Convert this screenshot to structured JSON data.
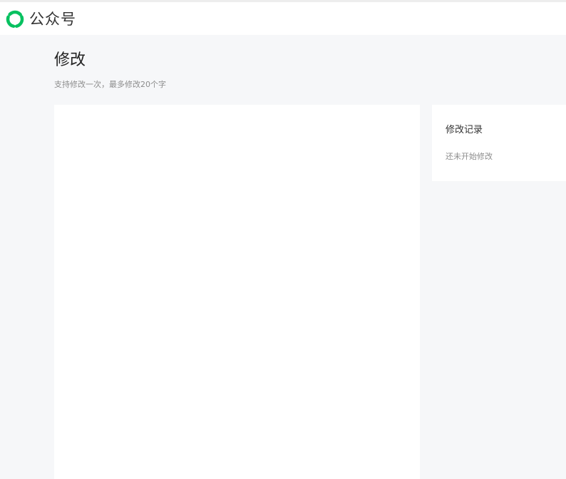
{
  "header": {
    "brand_name": "公众号",
    "logo_icon": "wechat-mp-logo-icon",
    "accent_color": "#07c160"
  },
  "page": {
    "title": "修改",
    "subtitle": "支持修改一次，最多修改20个字"
  },
  "history": {
    "title": "修改记录",
    "empty_text": "还未开始修改"
  }
}
